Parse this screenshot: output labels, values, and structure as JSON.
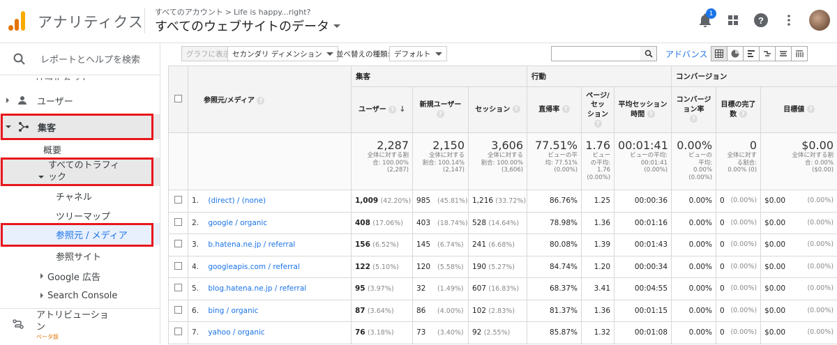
{
  "header": {
    "app_name": "アナリティクス",
    "breadcrumb_root": "すべてのアカウント",
    "breadcrumb_sep": ">",
    "breadcrumb_property": "Life is happy...right?",
    "view_title": "すべてのウェブサイトのデータ",
    "notification_count": "1"
  },
  "sidebar": {
    "search_text": "レポートとヘルプを検索",
    "ghost_text": "リアルタイム",
    "users": "ユーザー",
    "acquisition": "集客",
    "overview": "概要",
    "all_traffic_line1": "すべてのトラフィ",
    "all_traffic_line2": "ック",
    "channels": "チャネル",
    "treemap": "ツリーマップ",
    "source_medium": "参照元 / メディア",
    "referrals": "参照サイト",
    "google_ads": "Google 広告",
    "search_console": "Search Console",
    "attribution_line1": "アトリビューショ",
    "attribution_line2": "ン",
    "beta": "ベータ版"
  },
  "toolbar": {
    "graph_button": "グラフに表示",
    "secondary_dimension": "セカンダリ ディメンション",
    "sort_label": "並べ替えの種類:",
    "sort_value": "デフォルト",
    "advanced": "アドバンス"
  },
  "table": {
    "group_acquisition": "集客",
    "group_behavior": "行動",
    "group_conversion": "コンバージョン",
    "dim_header": "参照元/メディア",
    "col_users": "ユーザー",
    "col_new_users": "新規ユーザー",
    "col_sessions": "セッション",
    "col_bounce": "直帰率",
    "col_pages_1": "ページ/",
    "col_pages_2": "セッ",
    "col_pages_3": "ション",
    "col_duration_1": "平均セッション",
    "col_duration_2": "時間",
    "col_conv_1": "コンバージ",
    "col_conv_2": "ョン率",
    "col_goal_1": "目標の完了",
    "col_goal_2": "数",
    "col_goal_value": "目標値",
    "totals": {
      "users": "2,287",
      "users_s1": "全体に対する割",
      "users_s2": "合: 100.00%",
      "users_s3": "(2,287)",
      "new_users": "2,150",
      "new_users_s1": "全体に対する",
      "new_users_s2": "割合: 100.14%",
      "new_users_s3": "(2,147)",
      "sessions": "3,606",
      "sessions_s1": "全体に対する",
      "sessions_s2": "割合: 100.00%",
      "sessions_s3": "(3,606)",
      "bounce": "77.51%",
      "bounce_s1": "ビューの平",
      "bounce_s2": "均: 77.51%",
      "bounce_s3": "(0.00%)",
      "pages": "1.76",
      "pages_s1": "ビュー",
      "pages_s2": "の平均:",
      "pages_s3": "1.76",
      "pages_s4": "(0.00%)",
      "duration": "00:01:41",
      "duration_s1": "ビューの平均:",
      "duration_s2": "00:01:41",
      "duration_s3": "(0.00%)",
      "conv": "0.00%",
      "conv_s1": "ビューの",
      "conv_s2": "平均:",
      "conv_s3": "0.00%",
      "conv_s4": "(0.00%)",
      "goal": "0",
      "goal_s1": "全体に対す",
      "goal_s2": "る割合:",
      "goal_s3": "0.00% (0)",
      "value": "$0.00",
      "value_s1": "全体に対する割",
      "value_s2": "合: 0.00%",
      "value_s3": "($0.00)"
    },
    "rows": [
      {
        "n": "1.",
        "source": "(direct) / (none)",
        "users": "1,009",
        "users_p": "(42.20%)",
        "new": "985",
        "new_p": "(45.81%)",
        "sess": "1,216",
        "sess_p": "(33.72%)",
        "bounce": "86.76%",
        "pages": "1.25",
        "dur": "00:00:36",
        "conv": "0.00%",
        "goal": "0",
        "goal_p": "(0.00%)",
        "val": "$0.00",
        "val_p": "(0.00%)"
      },
      {
        "n": "2.",
        "source": "google / organic",
        "users": "408",
        "users_p": "(17.06%)",
        "new": "403",
        "new_p": "(18.74%)",
        "sess": "528",
        "sess_p": "(14.64%)",
        "bounce": "78.98%",
        "pages": "1.36",
        "dur": "00:01:16",
        "conv": "0.00%",
        "goal": "0",
        "goal_p": "(0.00%)",
        "val": "$0.00",
        "val_p": "(0.00%)"
      },
      {
        "n": "3.",
        "source": "b.hatena.ne.jp / referral",
        "users": "156",
        "users_p": "(6.52%)",
        "new": "145",
        "new_p": "(6.74%)",
        "sess": "241",
        "sess_p": "(6.68%)",
        "bounce": "80.08%",
        "pages": "1.39",
        "dur": "00:01:43",
        "conv": "0.00%",
        "goal": "0",
        "goal_p": "(0.00%)",
        "val": "$0.00",
        "val_p": "(0.00%)"
      },
      {
        "n": "4.",
        "source": "googleapis.com / referral",
        "users": "122",
        "users_p": "(5.10%)",
        "new": "120",
        "new_p": "(5.58%)",
        "sess": "190",
        "sess_p": "(5.27%)",
        "bounce": "84.74%",
        "pages": "1.20",
        "dur": "00:00:34",
        "conv": "0.00%",
        "goal": "0",
        "goal_p": "(0.00%)",
        "val": "$0.00",
        "val_p": "(0.00%)"
      },
      {
        "n": "5.",
        "source": "blog.hatena.ne.jp / referral",
        "users": "95",
        "users_p": "(3.97%)",
        "new": "32",
        "new_p": "(1.49%)",
        "sess": "607",
        "sess_p": "(16.83%)",
        "bounce": "68.37%",
        "pages": "3.41",
        "dur": "00:04:55",
        "conv": "0.00%",
        "goal": "0",
        "goal_p": "(0.00%)",
        "val": "$0.00",
        "val_p": "(0.00%)"
      },
      {
        "n": "6.",
        "source": "bing / organic",
        "users": "87",
        "users_p": "(3.64%)",
        "new": "86",
        "new_p": "(4.00%)",
        "sess": "102",
        "sess_p": "(2.83%)",
        "bounce": "81.37%",
        "pages": "1.36",
        "dur": "00:01:15",
        "conv": "0.00%",
        "goal": "0",
        "goal_p": "(0.00%)",
        "val": "$0.00",
        "val_p": "(0.00%)"
      },
      {
        "n": "7.",
        "source": "yahoo / organic",
        "users": "76",
        "users_p": "(3.18%)",
        "new": "73",
        "new_p": "(3.40%)",
        "sess": "92",
        "sess_p": "(2.55%)",
        "bounce": "85.87%",
        "pages": "1.32",
        "dur": "00:01:08",
        "conv": "0.00%",
        "goal": "0",
        "goal_p": "(0.00%)",
        "val": "$0.00",
        "val_p": "(0.00%)"
      }
    ]
  }
}
